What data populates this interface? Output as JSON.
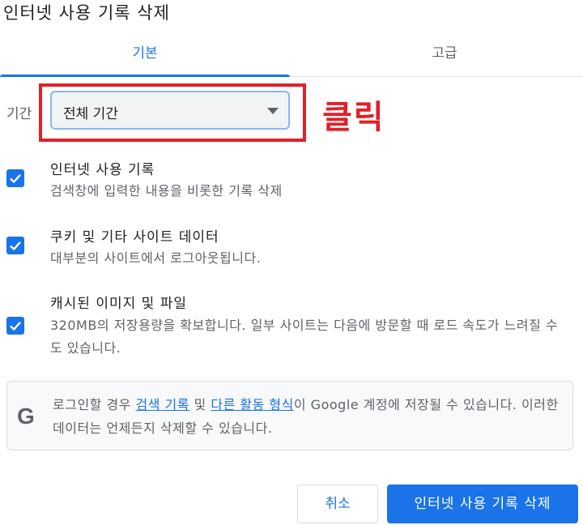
{
  "dialog": {
    "title": "인터넷 사용 기록 삭제"
  },
  "tabs": [
    {
      "label": "기본",
      "active": true
    },
    {
      "label": "고급",
      "active": false
    }
  ],
  "period": {
    "label": "기간",
    "selected": "전체 기간"
  },
  "annotation": {
    "text": "클릭",
    "color": "#e0202a"
  },
  "options": [
    {
      "title": "인터넷 사용 기록",
      "desc": "검색창에 입력한 내용을 비롯한 기록 삭제",
      "checked": true
    },
    {
      "title": "쿠키 및 기타 사이트 데이터",
      "desc": "대부분의 사이트에서 로그아웃됩니다.",
      "checked": true
    },
    {
      "title": "캐시된 이미지 및 파일",
      "desc": "320MB의 저장용량을 확보합니다. 일부 사이트는 다음에 방문할 때 로드 속도가 느려질 수도 있습니다.",
      "checked": true
    }
  ],
  "info": {
    "icon": "google-g-icon",
    "text_before": "로그인할 경우 ",
    "link1": "검색 기록",
    "text_mid": " 및 ",
    "link2": "다른 활동 형식",
    "text_after": "이 Google 계정에 저장될 수 있습니다. 이러한 데이터는 언제든지 삭제할 수 있습니다."
  },
  "buttons": {
    "cancel": "취소",
    "delete": "인터넷 사용 기록 삭제"
  },
  "colors": {
    "accent": "#1a73e8",
    "highlight": "#e0202a"
  }
}
